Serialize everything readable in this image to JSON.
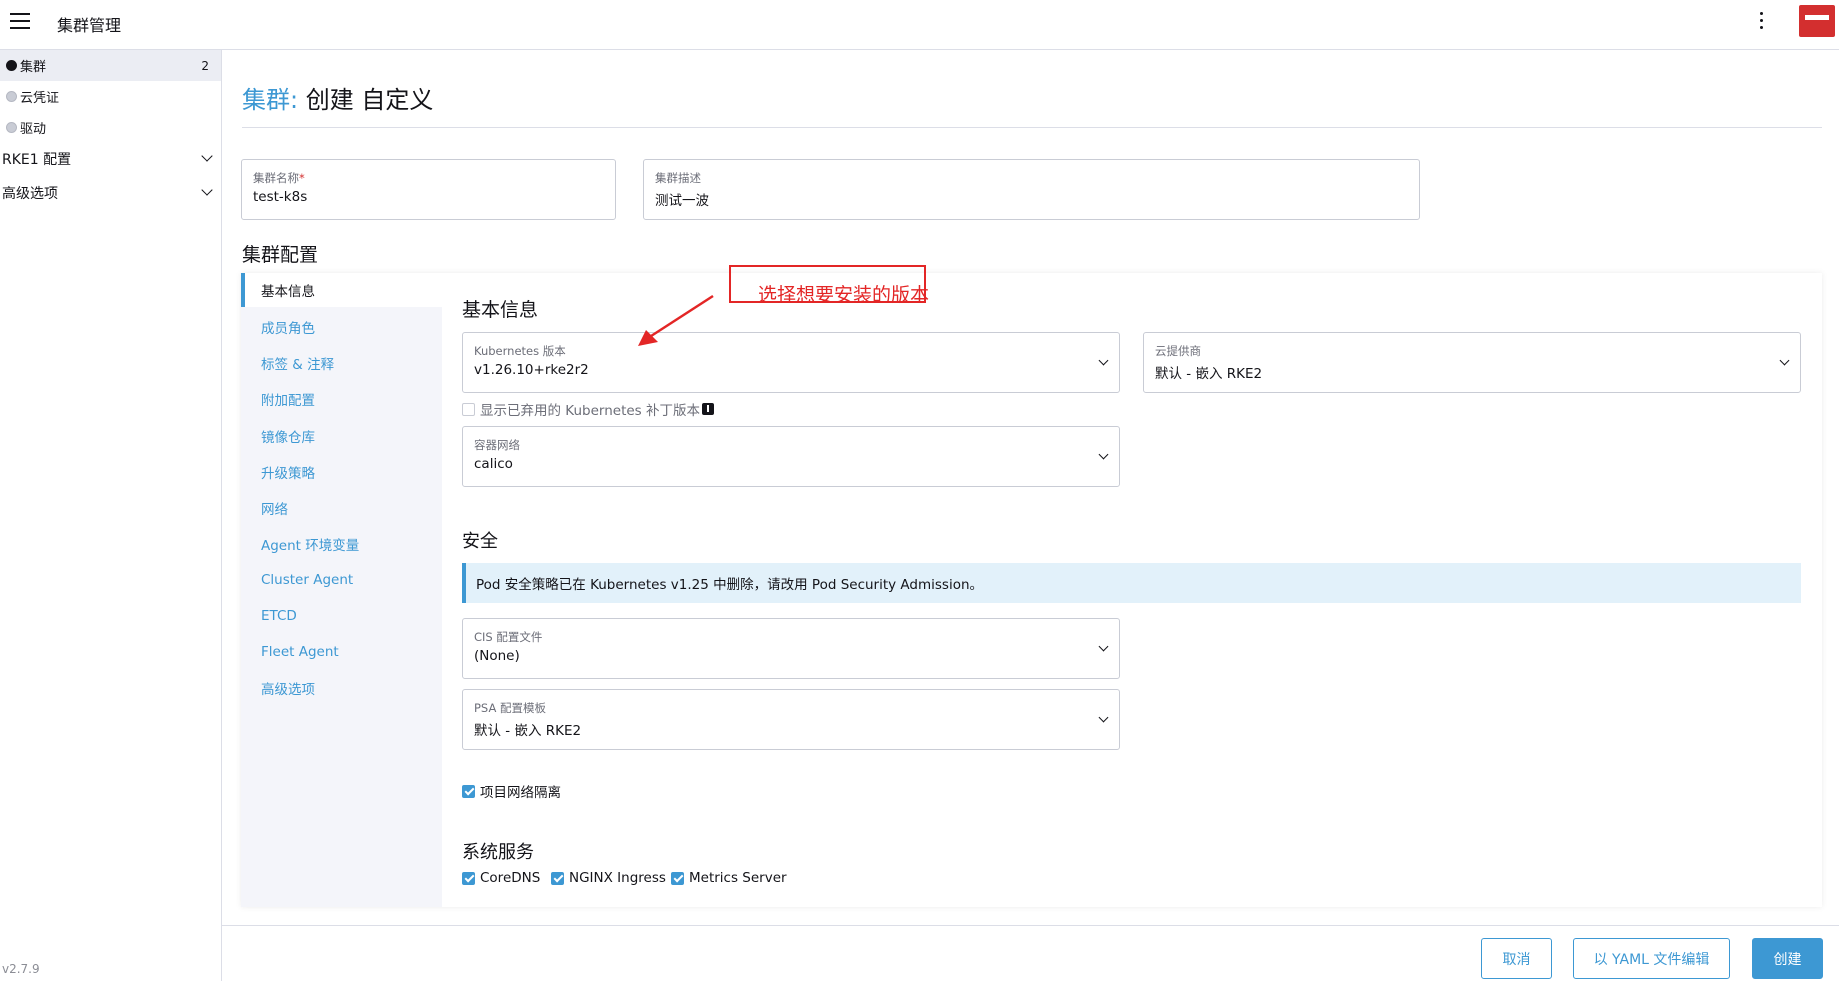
{
  "header": {
    "title": "集群管理"
  },
  "sidebar": {
    "items": [
      {
        "label": "集群",
        "count": "2"
      },
      {
        "label": "云凭证"
      },
      {
        "label": "驱动"
      }
    ],
    "groups": [
      {
        "label": "RKE1 配置"
      },
      {
        "label": "高级选项"
      }
    ],
    "version": "v2.7.9"
  },
  "page": {
    "crumb": "集群:",
    "title": "创建 自定义"
  },
  "cluster_name": {
    "label": "集群名称",
    "required_mark": "*",
    "value": "test-k8s"
  },
  "cluster_desc": {
    "label": "集群描述",
    "value": "测试一波"
  },
  "config": {
    "heading": "集群配置",
    "tabs": [
      "基本信息",
      "成员角色",
      "标签 & 注释",
      "附加配置",
      "镜像仓库",
      "升级策略",
      "网络",
      "Agent 环境变量",
      "Cluster Agent",
      "ETCD",
      "Fleet Agent",
      "高级选项"
    ]
  },
  "basic": {
    "heading": "基本信息",
    "k8s_version": {
      "label": "Kubernetes 版本",
      "value": "v1.26.10+rke2r2"
    },
    "cloud_provider": {
      "label": "云提供商",
      "value": "默认 - 嵌入 RKE2"
    },
    "show_deprecated": "显示已弃用的 Kubernetes 补丁版本",
    "cni": {
      "label": "容器网络",
      "value": "calico"
    }
  },
  "security": {
    "heading": "安全",
    "banner": "Pod 安全策略已在 Kubernetes v1.25 中删除，请改用 Pod Security Admission。",
    "cis": {
      "label": "CIS 配置文件",
      "value": "(None)"
    },
    "psa": {
      "label": "PSA 配置模板",
      "value": "默认 - 嵌入 RKE2"
    },
    "network_isolation": "项目网络隔离"
  },
  "services": {
    "heading": "系统服务",
    "items": [
      "CoreDNS",
      "NGINX Ingress",
      "Metrics Server"
    ]
  },
  "annotation": {
    "text": "选择想要安装的版本"
  },
  "footer": {
    "cancel": "取消",
    "yaml": "以 YAML 文件编辑",
    "create": "创建"
  },
  "colors": {
    "accent": "#3d98d3",
    "annotation": "#e32626"
  }
}
